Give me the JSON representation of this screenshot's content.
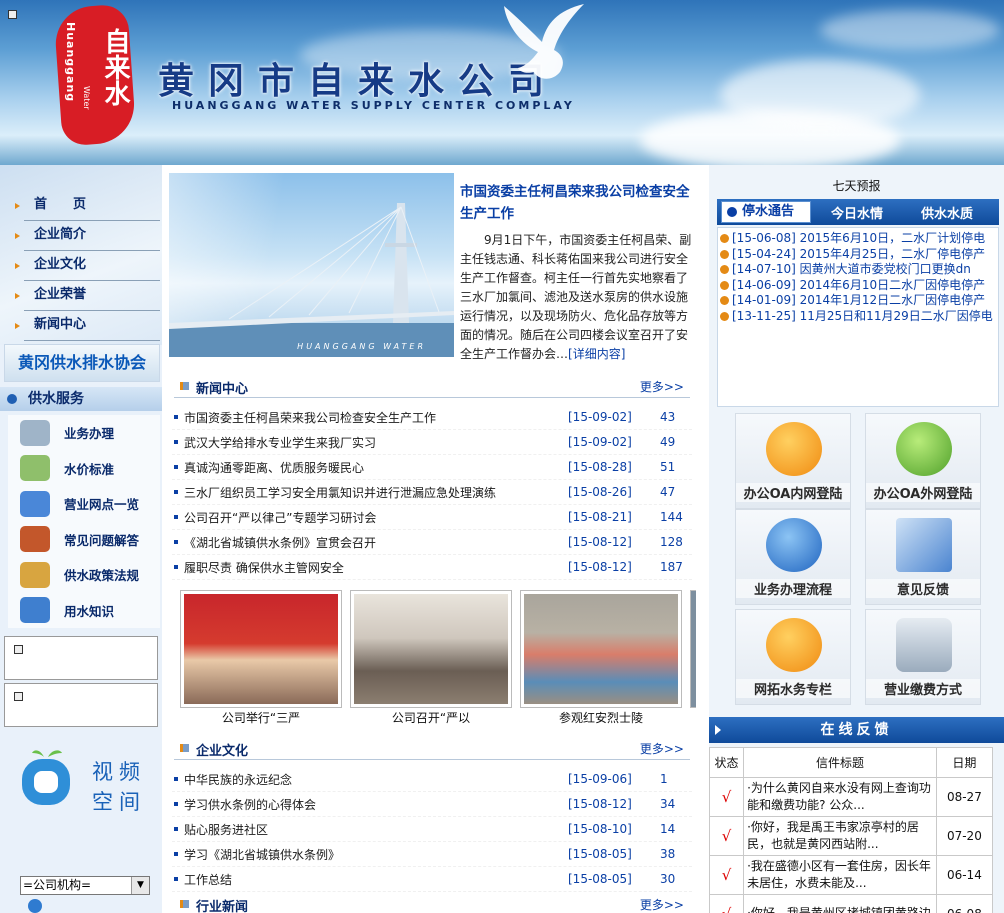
{
  "header": {
    "logo_text": "自来水",
    "logo_en": "Huanggang",
    "logo_en2": "Water",
    "title": "黄冈市自来水公司",
    "subtitle": "HUANGGANG WATER SUPPLY CENTER COMPLAY"
  },
  "nav": {
    "items": [
      {
        "label": "首　　页"
      },
      {
        "label": "企业简介"
      },
      {
        "label": "企业文化"
      },
      {
        "label": "企业荣誉"
      },
      {
        "label": "新闻中心"
      }
    ]
  },
  "assoc_banner": "黄冈供水排水协会",
  "services": {
    "title": "供水服务",
    "items": [
      {
        "label": "业务办理",
        "icon": "folder-icon",
        "color": "#9fb4c8"
      },
      {
        "label": "水价标准",
        "icon": "money-icon",
        "color": "#8fbf6b"
      },
      {
        "label": "营业网点一览",
        "icon": "network-icon",
        "color": "#4a87d8"
      },
      {
        "label": "常见问题解答",
        "icon": "books-icon",
        "color": "#c3572b"
      },
      {
        "label": "供水政策法规",
        "icon": "scroll-icon",
        "color": "#d8a540"
      },
      {
        "label": "用水知识",
        "icon": "magnifier-icon",
        "color": "#3f7fcf"
      }
    ]
  },
  "video": {
    "label": "视频空间"
  },
  "org_select": {
    "value": "=公司机构="
  },
  "lead": {
    "photo_caption": "HUANGGANG WATER",
    "title": "市国资委主任柯昌荣来我公司检查安全生产工作",
    "body": "9月1日下午，市国资委主任柯昌荣、副主任钱志通、科长蒋佑国来我公司进行安全生产工作督查。柯主任一行首先实地察看了三水厂加氯间、滤池及送水泵房的供水设施运行情况，以及现场防火、危化品存放等方面的情况。随后在公司四楼会议室召开了安全生产工作督办会…",
    "more": "[详细内容]"
  },
  "news_center": {
    "title": "新闻中心",
    "more": "更多>>",
    "rows": [
      {
        "title": "市国资委主任柯昌荣来我公司检查安全生产工作",
        "date": "[15-09-02]",
        "count": "43"
      },
      {
        "title": "武汉大学给排水专业学生来我厂实习",
        "date": "[15-09-02]",
        "count": "49"
      },
      {
        "title": "真诚沟通零距离、优质服务暖民心",
        "date": "[15-08-28]",
        "count": "51"
      },
      {
        "title": "三水厂组织员工学习安全用氯知识并进行泄漏应急处理演练",
        "date": "[15-08-26]",
        "count": "47"
      },
      {
        "title": "公司召开“严以律己”专题学习研讨会",
        "date": "[15-08-21]",
        "count": "144"
      },
      {
        "title": "《湖北省城镇供水条例》宣贯会召开",
        "date": "[15-08-12]",
        "count": "128"
      },
      {
        "title": "履职尽责 确保供水主管网安全",
        "date": "[15-08-12]",
        "count": "187"
      }
    ]
  },
  "photos": [
    {
      "caption": "公司举行“三严"
    },
    {
      "caption": "公司召开“严以"
    },
    {
      "caption": "参观红安烈士陵"
    }
  ],
  "culture": {
    "title": "企业文化",
    "more": "更多>>",
    "rows": [
      {
        "title": "中华民族的永远纪念",
        "date": "[15-09-06]",
        "count": "1"
      },
      {
        "title": "学习供水条例的心得体会",
        "date": "[15-08-12]",
        "count": "34"
      },
      {
        "title": "贴心服务进社区",
        "date": "[15-08-10]",
        "count": "14"
      },
      {
        "title": "学习《湖北省城镇供水条例》",
        "date": "[15-08-05]",
        "count": "38"
      },
      {
        "title": "工作总结",
        "date": "[15-08-05]",
        "count": "30"
      }
    ]
  },
  "industry": {
    "title": "行业新闻",
    "more": "更多>>"
  },
  "right": {
    "forecast": "七天预报",
    "tabs": [
      "停水通告",
      "今日水情",
      "供水水质"
    ],
    "notices": [
      "[15-06-08] 2015年6月10日，二水厂计划停电",
      "[15-04-24] 2015年4月25日，二水厂停电停产",
      "[14-07-10] 因黄州大道市委党校门口更换dn",
      "[14-06-09] 2014年6月10日二水厂因停电停产",
      "[14-01-09] 2014年1月12日二水厂因停电停产",
      "[13-11-25] 11月25日和11月29日二水厂因停电"
    ],
    "tiles": [
      {
        "label": "办公OA内网登陆",
        "icon": "user-alert-icon",
        "color": "#f0a020"
      },
      {
        "label": "办公OA外网登陆",
        "icon": "user-music-icon",
        "color": "#70c040"
      },
      {
        "label": "业务办理流程",
        "icon": "ie-icon",
        "color": "#2f7bd0"
      },
      {
        "label": "意见反馈",
        "icon": "document-pen-icon",
        "color": "#5a8fd8"
      },
      {
        "label": "网拓水务专栏",
        "icon": "user-alert-icon",
        "color": "#f0a020"
      },
      {
        "label": "营业缴费方式",
        "icon": "server-check-icon",
        "color": "#8aa0b8"
      }
    ],
    "feedback": {
      "title": "在线反馈",
      "headers": [
        "状态",
        "信件标题",
        "日期"
      ],
      "rows": [
        {
          "status": "√",
          "title": "·为什么黄冈自来水没有网上查询功能和缴费功能? 公众...",
          "date": "08-27"
        },
        {
          "status": "√",
          "title": "·你好，我是禹王韦家凉亭村的居民，也就是黄冈西站附...",
          "date": "07-20"
        },
        {
          "status": "√",
          "title": "·我在盛德小区有一套住房，因长年未居住，水费未能及...",
          "date": "06-14"
        },
        {
          "status": "√",
          "title": "·你好，我是黄州区堵城镇团黄路边",
          "date": "06-08"
        }
      ]
    }
  }
}
